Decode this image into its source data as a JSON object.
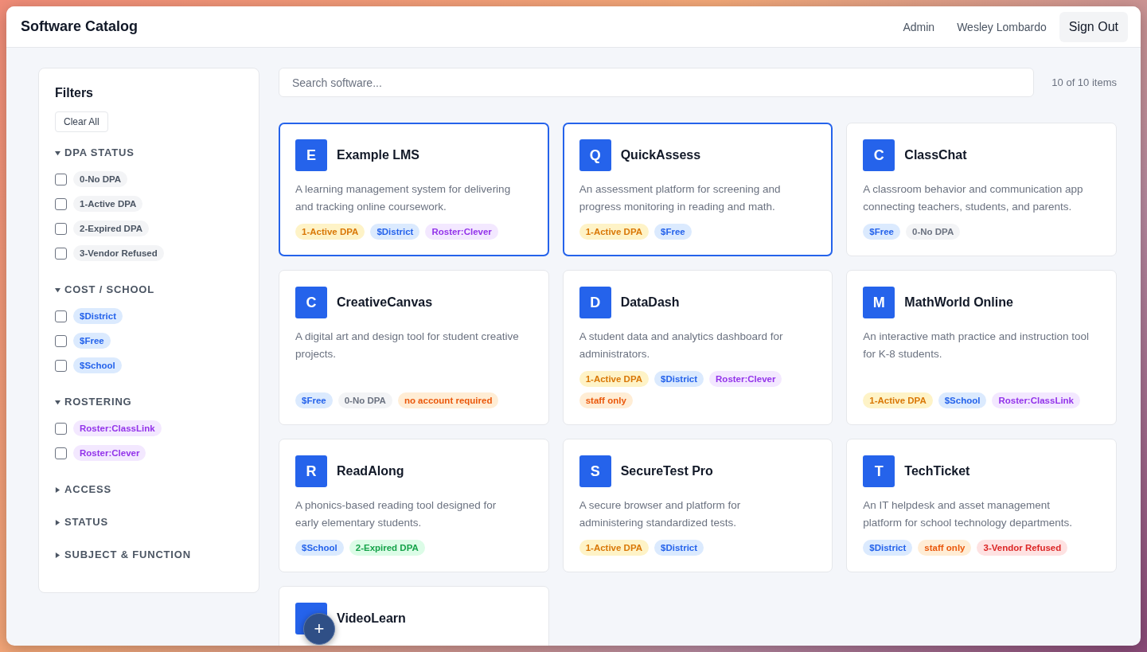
{
  "header": {
    "title": "Software Catalog",
    "nav": [
      {
        "label": "Admin",
        "kind": "link"
      },
      {
        "label": "Wesley Lombardo",
        "kind": "link"
      },
      {
        "label": "Sign Out",
        "kind": "button"
      }
    ]
  },
  "filters": {
    "title": "Filters",
    "clear_button": "Clear All",
    "sections": [
      {
        "label": "DPA STATUS",
        "expanded": true,
        "options": [
          {
            "label": "0-No DPA",
            "checked": false,
            "color": "#4b5563"
          },
          {
            "label": "1-Active DPA",
            "checked": false,
            "color": "#4b5563"
          },
          {
            "label": "2-Expired DPA",
            "checked": false,
            "color": "#4b5563"
          },
          {
            "label": "3-Vendor Refused",
            "checked": false,
            "color": "#4b5563"
          }
        ]
      },
      {
        "label": "COST / SCHOOL",
        "expanded": true,
        "options": [
          {
            "label": "$District",
            "checked": false,
            "color": "#2563eb"
          },
          {
            "label": "$Free",
            "checked": false,
            "color": "#2563eb"
          },
          {
            "label": "$School",
            "checked": false,
            "color": "#2563eb"
          }
        ]
      },
      {
        "label": "ROSTERING",
        "expanded": true,
        "options": [
          {
            "label": "Roster:ClassLink",
            "checked": false,
            "color": "#9333ea"
          },
          {
            "label": "Roster:Clever",
            "checked": false,
            "color": "#9333ea"
          }
        ]
      },
      {
        "label": "ACCESS",
        "expanded": false
      },
      {
        "label": "STATUS",
        "expanded": false
      },
      {
        "label": "SUBJECT & FUNCTION",
        "expanded": false
      }
    ]
  },
  "search": {
    "placeholder": "Search software..."
  },
  "count": "10 of 10 items",
  "cards": [
    {
      "letter": "E",
      "name": "Example LMS",
      "selected": true,
      "description": "A learning management system for delivering and tracking online coursework.",
      "tags": [
        {
          "label": "1-Active DPA",
          "color": "#d97706"
        },
        {
          "label": "$District",
          "color": "#2563eb"
        },
        {
          "label": "Roster:Clever",
          "color": "#9333ea"
        }
      ]
    },
    {
      "letter": "Q",
      "name": "QuickAssess",
      "selected": true,
      "description": "An assessment platform for screening and progress monitoring in reading and math.",
      "tags": [
        {
          "label": "1-Active DPA",
          "color": "#d97706"
        },
        {
          "label": "$Free",
          "color": "#2563eb"
        }
      ]
    },
    {
      "letter": "C",
      "name": "ClassChat",
      "selected": false,
      "description": "A classroom behavior and communication app connecting teachers, students, and parents.",
      "tags": [
        {
          "label": "$Free",
          "color": "#2563eb"
        },
        {
          "label": "0-No DPA",
          "color": "#6b7280"
        }
      ]
    },
    {
      "letter": "C",
      "name": "CreativeCanvas",
      "selected": false,
      "description": "A digital art and design tool for student creative projects.",
      "tags": [
        {
          "label": "$Free",
          "color": "#2563eb"
        },
        {
          "label": "0-No DPA",
          "color": "#6b7280"
        },
        {
          "label": "no account required",
          "color": "#ea580c"
        }
      ]
    },
    {
      "letter": "D",
      "name": "DataDash",
      "selected": false,
      "description": "A student data and analytics dashboard for administrators.",
      "tags": [
        {
          "label": "1-Active DPA",
          "color": "#d97706"
        },
        {
          "label": "$District",
          "color": "#2563eb"
        },
        {
          "label": "Roster:Clever",
          "color": "#9333ea"
        },
        {
          "label": "staff only",
          "color": "#ea580c"
        }
      ]
    },
    {
      "letter": "M",
      "name": "MathWorld Online",
      "selected": false,
      "description": "An interactive math practice and instruction tool for K-8 students.",
      "tags": [
        {
          "label": "1-Active DPA",
          "color": "#d97706"
        },
        {
          "label": "$School",
          "color": "#2563eb"
        },
        {
          "label": "Roster:ClassLink",
          "color": "#9333ea"
        }
      ]
    },
    {
      "letter": "R",
      "name": "ReadAlong",
      "selected": false,
      "description": "A phonics-based reading tool designed for early elementary students.",
      "tags": [
        {
          "label": "$School",
          "color": "#2563eb"
        },
        {
          "label": "2-Expired DPA",
          "color": "#16a34a"
        }
      ]
    },
    {
      "letter": "S",
      "name": "SecureTest Pro",
      "selected": false,
      "description": "A secure browser and platform for administering standardized tests.",
      "tags": [
        {
          "label": "1-Active DPA",
          "color": "#d97706"
        },
        {
          "label": "$District",
          "color": "#2563eb"
        }
      ]
    },
    {
      "letter": "T",
      "name": "TechTicket",
      "selected": false,
      "description": "An IT helpdesk and asset management platform for school technology departments.",
      "tags": [
        {
          "label": "$District",
          "color": "#2563eb"
        },
        {
          "label": "staff only",
          "color": "#ea580c"
        },
        {
          "label": "3-Vendor Refused",
          "color": "#dc2626"
        }
      ]
    },
    {
      "name": "VideoLearn",
      "selected": false
    }
  ],
  "fab": {
    "label": "+"
  }
}
